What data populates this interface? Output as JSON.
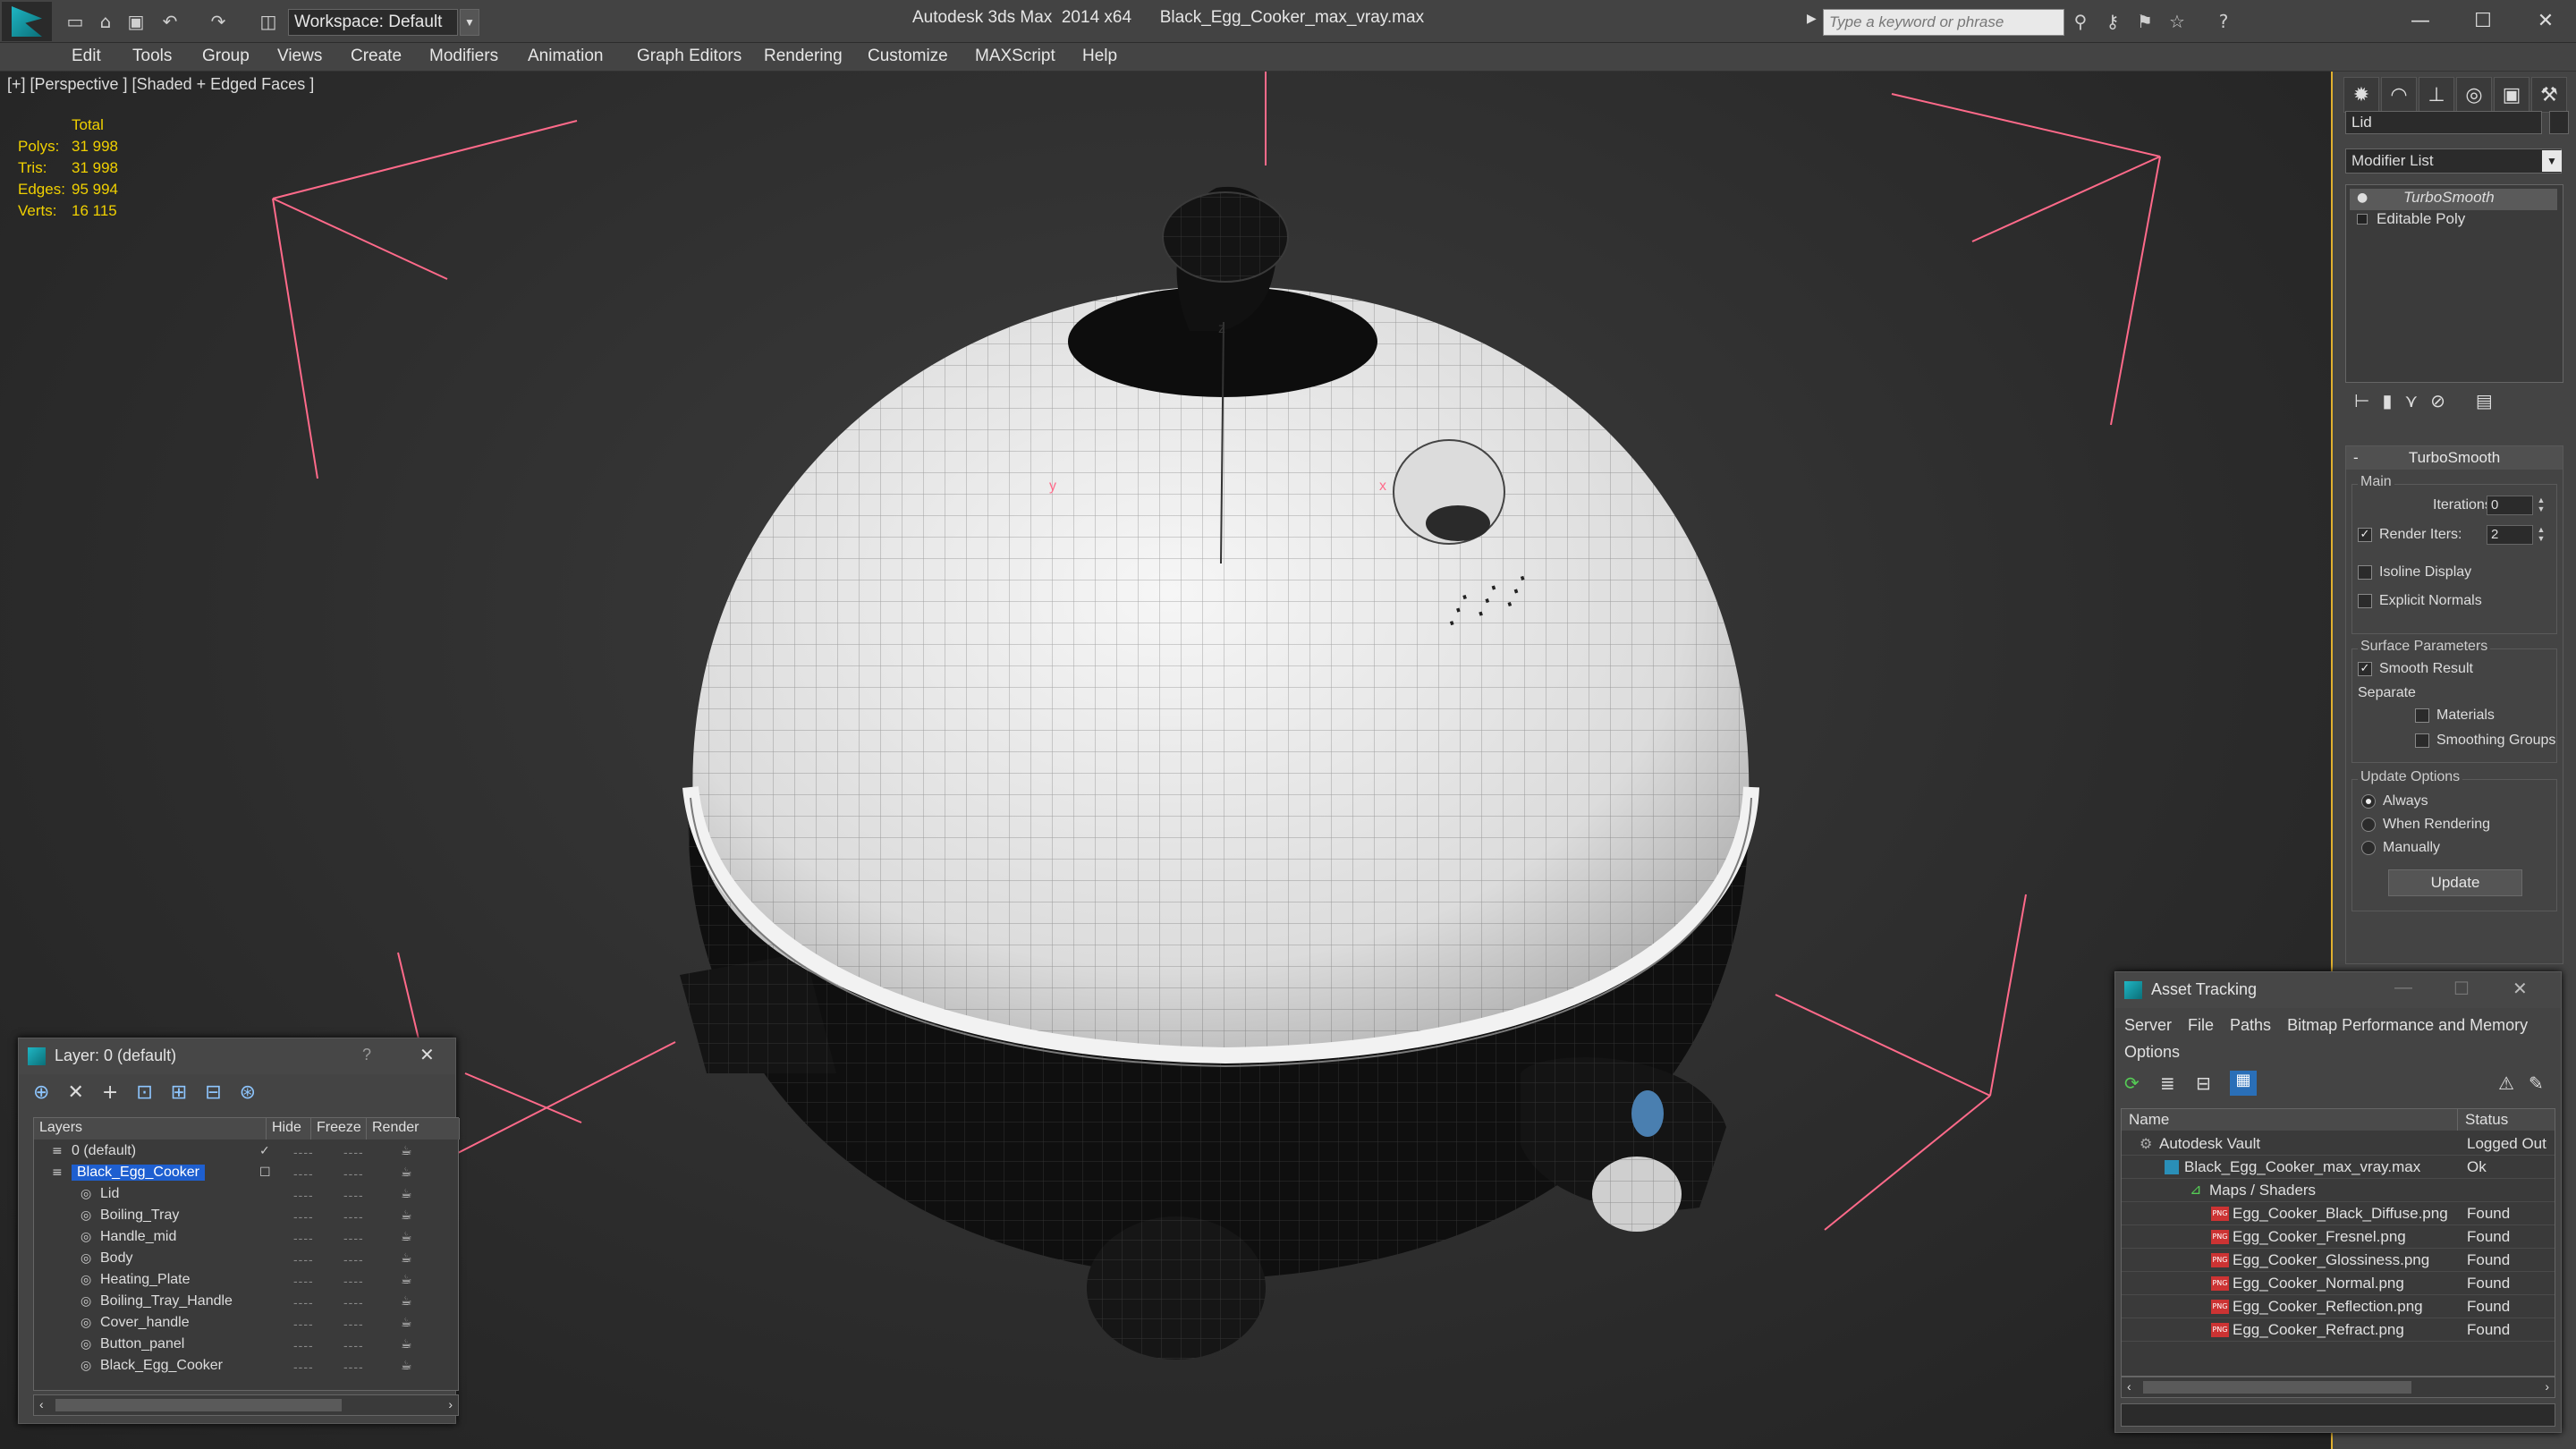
{
  "titlebar": {
    "workspace": "Workspace: Default",
    "app_name": "Autodesk 3ds Max  2014 x64",
    "file_name": "Black_Egg_Cooker_max_vray.max",
    "search_placeholder": "Type a keyword or phrase"
  },
  "menu": [
    "Edit",
    "Tools",
    "Group",
    "Views",
    "Create",
    "Modifiers",
    "Animation",
    "Graph Editors",
    "Rendering",
    "Customize",
    "MAXScript",
    "Help"
  ],
  "viewport": {
    "label": "[+] [Perspective ] [Shaded + Edged Faces ]",
    "stats": {
      "total_label": "Total",
      "rows": [
        {
          "k": "Polys:",
          "v": "31 998"
        },
        {
          "k": "Tris:",
          "v": "31 998"
        },
        {
          "k": "Edges:",
          "v": "95 994"
        },
        {
          "k": "Verts:",
          "v": "16 115"
        }
      ]
    },
    "colors": {
      "wire": "#0a0a0a",
      "shell": "#e8e8e8",
      "body": "#111111",
      "grid": "#ff6a8a",
      "stats": "#f0d000"
    }
  },
  "command_panel": {
    "object_name": "Lid",
    "modifier_list": "Modifier List",
    "stack": [
      "TurboSmooth",
      "Editable Poly"
    ],
    "rollout_title": "TurboSmooth",
    "main": {
      "title": "Main",
      "iterations_label": "Iterations:",
      "iterations_value": "0",
      "render_iters_label": "Render Iters:",
      "render_iters_value": "2",
      "isoline": "Isoline Display",
      "explicit": "Explicit Normals"
    },
    "surface": {
      "title": "Surface Parameters",
      "smooth": "Smooth Result",
      "separate": "Separate",
      "materials": "Materials",
      "smoothing_groups": "Smoothing Groups"
    },
    "update": {
      "title": "Update Options",
      "always": "Always",
      "when_rendering": "When Rendering",
      "manually": "Manually",
      "button": "Update"
    }
  },
  "layer_window": {
    "title": "Layer: 0 (default)",
    "help": "?",
    "columns": [
      "Layers",
      "Hide",
      "Freeze",
      "Render"
    ],
    "rows": [
      {
        "name": "0 (default)",
        "indent": 1
      },
      {
        "name": "Black_Egg_Cooker",
        "indent": 1
      },
      {
        "name": "Lid",
        "indent": 2
      },
      {
        "name": "Boiling_Tray",
        "indent": 2
      },
      {
        "name": "Handle_mid",
        "indent": 2
      },
      {
        "name": "Body",
        "indent": 2
      },
      {
        "name": "Heating_Plate",
        "indent": 2
      },
      {
        "name": "Boiling_Tray_Handle",
        "indent": 2
      },
      {
        "name": "Cover_handle",
        "indent": 2
      },
      {
        "name": "Button_panel",
        "indent": 2
      },
      {
        "name": "Black_Egg_Cooker",
        "indent": 2
      }
    ]
  },
  "asset_window": {
    "title": "Asset Tracking",
    "menu": [
      "Server",
      "File",
      "Paths",
      "Bitmap Performance and Memory",
      "Options"
    ],
    "columns": [
      "Name",
      "Status"
    ],
    "rows": [
      {
        "name": "Autodesk Vault",
        "status": "Logged Out",
        "level": 0
      },
      {
        "name": "Black_Egg_Cooker_max_vray.max",
        "status": "Ok",
        "level": 1
      },
      {
        "name": "Maps / Shaders",
        "status": "",
        "level": 2
      },
      {
        "name": "Egg_Cooker_Black_Diffuse.png",
        "status": "Found",
        "level": 3
      },
      {
        "name": "Egg_Cooker_Fresnel.png",
        "status": "Found",
        "level": 3
      },
      {
        "name": "Egg_Cooker_Glossiness.png",
        "status": "Found",
        "level": 3
      },
      {
        "name": "Egg_Cooker_Normal.png",
        "status": "Found",
        "level": 3
      },
      {
        "name": "Egg_Cooker_Reflection.png",
        "status": "Found",
        "level": 3
      },
      {
        "name": "Egg_Cooker_Refract.png",
        "status": "Found",
        "level": 3
      }
    ]
  }
}
